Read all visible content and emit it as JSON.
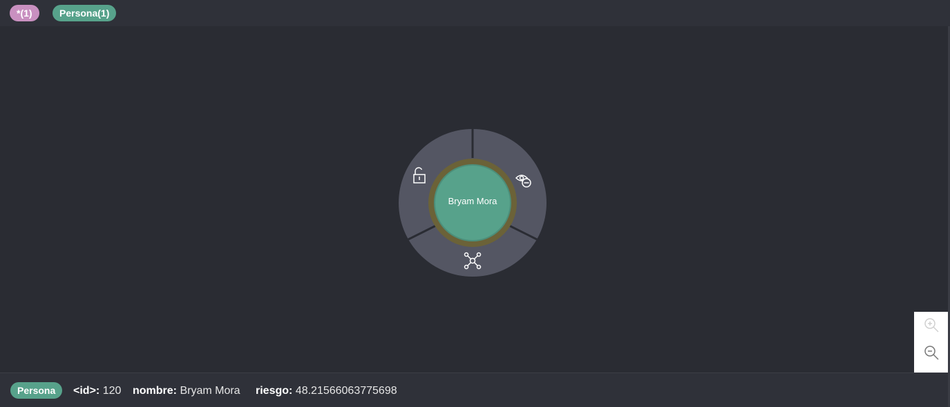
{
  "legend": {
    "all_label": "*(1)",
    "persona_label": "Persona(1)"
  },
  "node": {
    "caption": "Bryam Mora",
    "fill_color": "#57a28b",
    "halo_color": "#6b6238",
    "ring_color": "#545663",
    "ring_icons": [
      "unlock-icon",
      "hide-icon",
      "expand-icon"
    ]
  },
  "zoom": {
    "in_icon": "zoom-in-icon",
    "out_icon": "zoom-out-icon"
  },
  "status": {
    "label": "Persona",
    "props": [
      {
        "key": "<id>:",
        "value": "120"
      },
      {
        "key": "nombre:",
        "value": "Bryam Mora"
      },
      {
        "key": "riesgo:",
        "value": "48.21566063775698"
      }
    ]
  }
}
